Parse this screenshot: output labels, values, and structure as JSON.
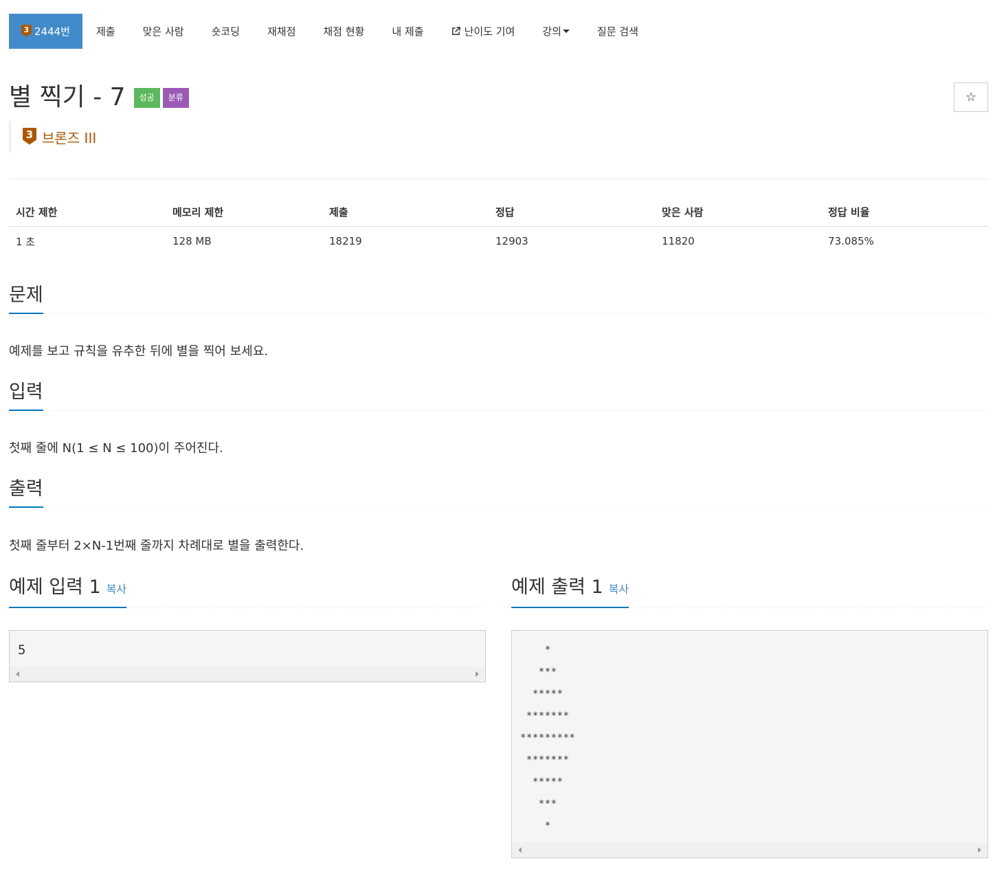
{
  "tabs": [
    {
      "label": "2444번",
      "tier": "3"
    },
    {
      "label": "제출"
    },
    {
      "label": "맞은 사람"
    },
    {
      "label": "숏코딩"
    },
    {
      "label": "재채점"
    },
    {
      "label": "채점 현황"
    },
    {
      "label": "내 제출"
    },
    {
      "label": "난이도 기여"
    },
    {
      "label": "강의"
    },
    {
      "label": "질문 검색"
    }
  ],
  "problem": {
    "title": "별 찍기 - 7",
    "label_success": "성공",
    "label_category": "분류",
    "star": "☆",
    "tier_num": "3",
    "tier_text": "브론즈 III"
  },
  "info": {
    "headers": [
      "시간 제한",
      "메모리 제한",
      "제출",
      "정답",
      "맞은 사람",
      "정답 비율"
    ],
    "values": [
      "1 초",
      "128 MB",
      "18219",
      "12903",
      "11820",
      "73.085%"
    ]
  },
  "sections": {
    "problem_h": "문제",
    "problem_p": "예제를 보고 규칙을 유추한 뒤에 별을 찍어 보세요.",
    "input_h": "입력",
    "input_p": "첫째 줄에 N(1 ≤ N ≤ 100)이 주어진다.",
    "output_h": "출력",
    "output_p": "첫째 줄부터 2×N-1번째 줄까지 차례대로 별을 출력한다."
  },
  "samples": {
    "input_title": "예제 입력 1",
    "output_title": "예제 출력 1",
    "copy": "복사",
    "input_code": "5",
    "output_code": "    *\n   ***\n  *****\n *******\n*********\n *******\n  *****\n   ***\n    *"
  }
}
